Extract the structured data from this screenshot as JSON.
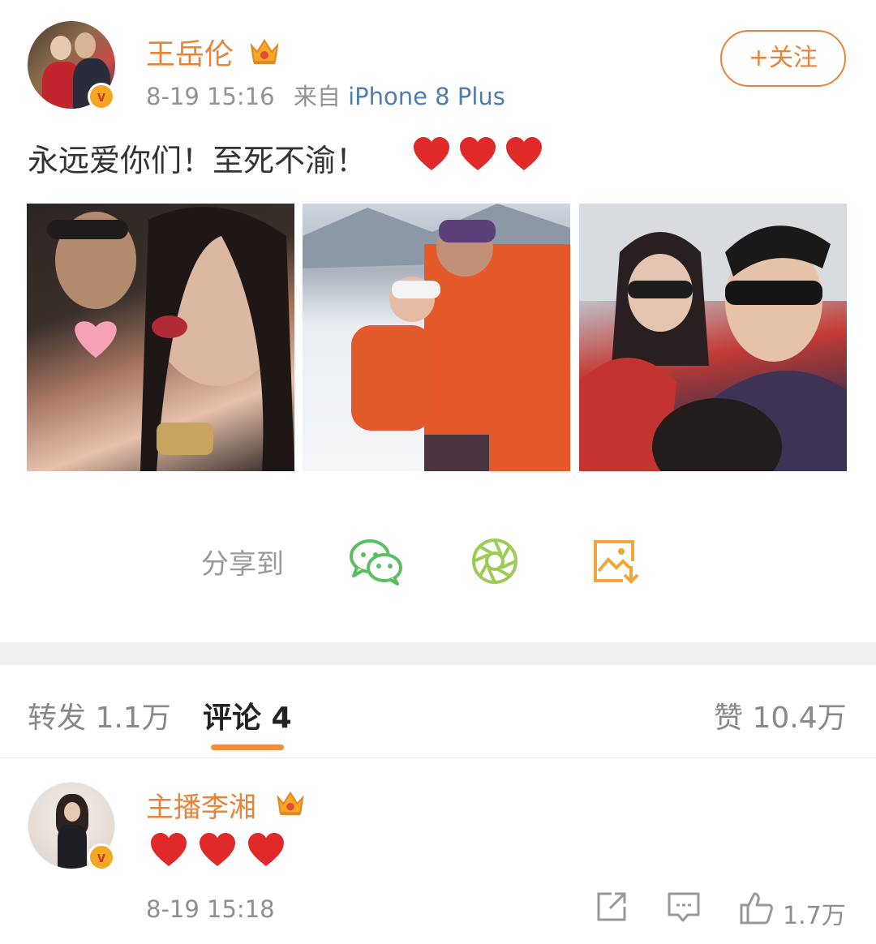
{
  "post": {
    "author": "王岳伦",
    "timestamp": "8-19 15:16",
    "source_prefix": "来自",
    "device": "iPhone 8 Plus",
    "follow_label": "+关注",
    "text": "永远爱你们！至死不渝！",
    "emoji_count": 3,
    "badge_letter": "v"
  },
  "share": {
    "label": "分享到",
    "targets": [
      "wechat-icon",
      "moments-icon",
      "save-image-icon"
    ]
  },
  "tabs": {
    "repost": "转发 1.1万",
    "comment": "评论 4",
    "like": "赞 10.4万"
  },
  "comment": {
    "author": "主播李湘",
    "timestamp": "8-19 15:18",
    "likes": "1.7万",
    "emoji_count": 3
  },
  "colors": {
    "accent": "#e8833a",
    "link": "#507daf",
    "heart": "#e02a2a",
    "wechat": "#5bbf62",
    "moments": "#9ccb56",
    "save": "#f0a63a"
  }
}
